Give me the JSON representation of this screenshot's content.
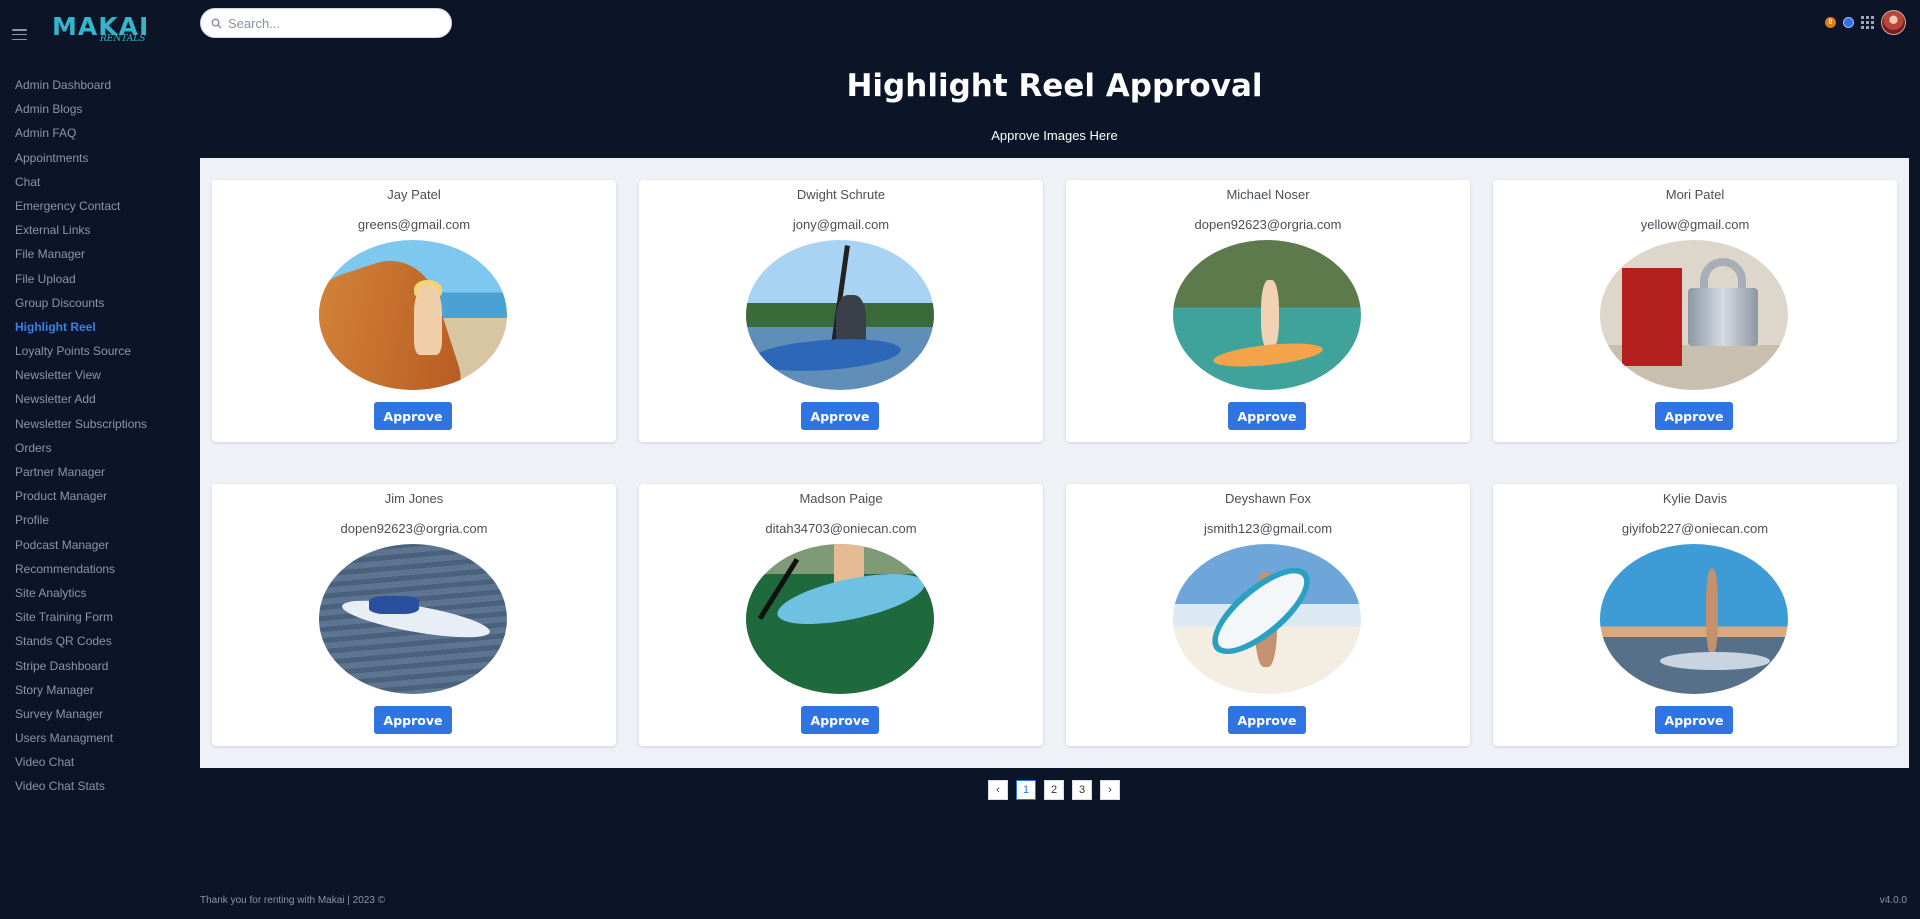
{
  "brand": {
    "logo_main": "MAKAI",
    "logo_sub": "RENTALS",
    "accent": "#35b5cc"
  },
  "search": {
    "placeholder": "Search..."
  },
  "topbar": {
    "notification_count": "0"
  },
  "sidebar": {
    "items": [
      {
        "label": "Admin Dashboard"
      },
      {
        "label": "Admin Blogs"
      },
      {
        "label": "Admin FAQ"
      },
      {
        "label": "Appointments"
      },
      {
        "label": "Chat"
      },
      {
        "label": "Emergency Contact"
      },
      {
        "label": "External Links"
      },
      {
        "label": "File Manager"
      },
      {
        "label": "File Upload"
      },
      {
        "label": "Group Discounts"
      },
      {
        "label": "Highlight Reel",
        "active": true
      },
      {
        "label": "Loyalty Points Source"
      },
      {
        "label": "Newsletter View"
      },
      {
        "label": "Newsletter Add"
      },
      {
        "label": "Newsletter Subscriptions"
      },
      {
        "label": "Orders"
      },
      {
        "label": "Partner Manager"
      },
      {
        "label": "Product Manager"
      },
      {
        "label": "Profile"
      },
      {
        "label": "Podcast Manager"
      },
      {
        "label": "Recommendations"
      },
      {
        "label": "Site Analytics"
      },
      {
        "label": "Site Training Form"
      },
      {
        "label": "Stands QR Codes"
      },
      {
        "label": "Stripe Dashboard"
      },
      {
        "label": "Story Manager"
      },
      {
        "label": "Survey Manager"
      },
      {
        "label": "Users Managment"
      },
      {
        "label": "Video Chat"
      },
      {
        "label": "Video Chat Stats"
      }
    ]
  },
  "header": {
    "title": "Highlight Reel Approval",
    "subtitle": "Approve Images Here"
  },
  "cards": [
    {
      "name": "Jay Patel",
      "email": "greens@gmail.com",
      "button": "Approve"
    },
    {
      "name": "Dwight Schrute",
      "email": "jony@gmail.com",
      "button": "Approve"
    },
    {
      "name": "Michael Noser",
      "email": "dopen92623@orgria.com",
      "button": "Approve"
    },
    {
      "name": "Mori Patel",
      "email": "yellow@gmail.com",
      "button": "Approve"
    },
    {
      "name": "Jim Jones",
      "email": "dopen92623@orgria.com",
      "button": "Approve"
    },
    {
      "name": "Madson Paige",
      "email": "ditah34703@oniecan.com",
      "button": "Approve"
    },
    {
      "name": "Deyshawn Fox",
      "email": "jsmith123@gmail.com",
      "button": "Approve"
    },
    {
      "name": "Kylie Davis",
      "email": "giyifob227@oniecan.com",
      "button": "Approve"
    }
  ],
  "pagination": {
    "prev": "‹",
    "pages": [
      "1",
      "2",
      "3"
    ],
    "next": "›",
    "current": "1"
  },
  "footer": {
    "text": "Thank you for renting with Makai | 2023 ©",
    "version": "v4.0.0"
  }
}
